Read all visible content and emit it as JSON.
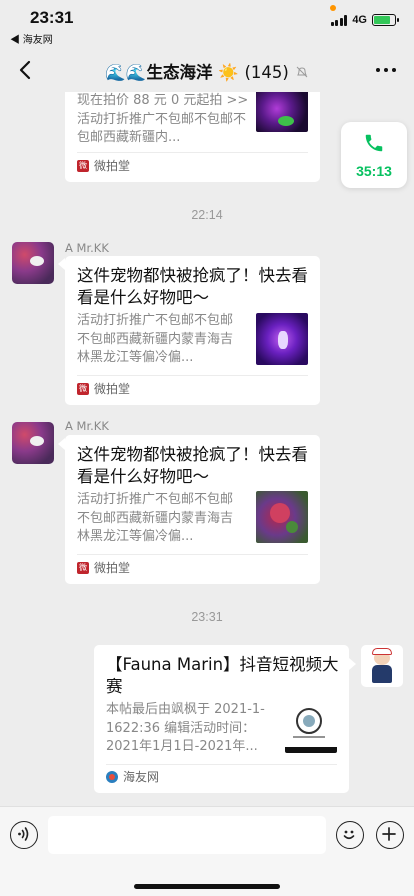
{
  "status_bar": {
    "time": "23:31",
    "back_app": "◀ 海友网",
    "network": "4G",
    "battery_percent": 80,
    "battery_color": "#34c759"
  },
  "nav": {
    "title": "生态海洋",
    "title_prefix_icons": "🌊🌊",
    "title_suffix_icon": "☀️",
    "member_count": "(145)",
    "mute_icon": "bell-off-icon",
    "more_icon": "more-dots-icon",
    "back_icon": "chevron-left-icon"
  },
  "call_float": {
    "icon": "phone-icon",
    "duration": "35:13",
    "color": "#07c160"
  },
  "messages": [
    {
      "type": "partial-card",
      "desc": "现在拍价 88 元 0 元起拍 >> 活动打折推广不包邮不包邮不包邮西藏新疆内...",
      "source": "微拍堂",
      "source_logo": "微"
    },
    {
      "type": "timestamp",
      "text": "22:14"
    },
    {
      "type": "card",
      "sender": "A  Mr.KK",
      "title": "这件宠物都快被抢疯了！快去看看是什么好物吧～",
      "desc": "活动打折推广不包邮不包邮不包邮西藏新疆内蒙青海吉林黑龙江等偏冷偏...",
      "source": "微拍堂",
      "source_logo": "微"
    },
    {
      "type": "card",
      "sender": "A  Mr.KK",
      "title": "这件宠物都快被抢疯了！快去看看是什么好物吧～",
      "desc": "活动打折推广不包邮不包邮不包邮西藏新疆内蒙青海吉林黑龙江等偏冷偏...",
      "source": "微拍堂",
      "source_logo": "微"
    },
    {
      "type": "timestamp",
      "text": "23:31"
    },
    {
      "type": "card-self",
      "title": "【Fauna Marin】抖音短视频大赛",
      "desc": "本帖最后由飒枫于 2021-1-1622:36 编辑活动时间：2021年1月1日-2021年...",
      "source": "海友网"
    }
  ],
  "input_bar": {
    "voice_icon": "voice-icon",
    "emoji_icon": "emoji-icon",
    "plus_icon": "plus-icon",
    "placeholder": ""
  }
}
